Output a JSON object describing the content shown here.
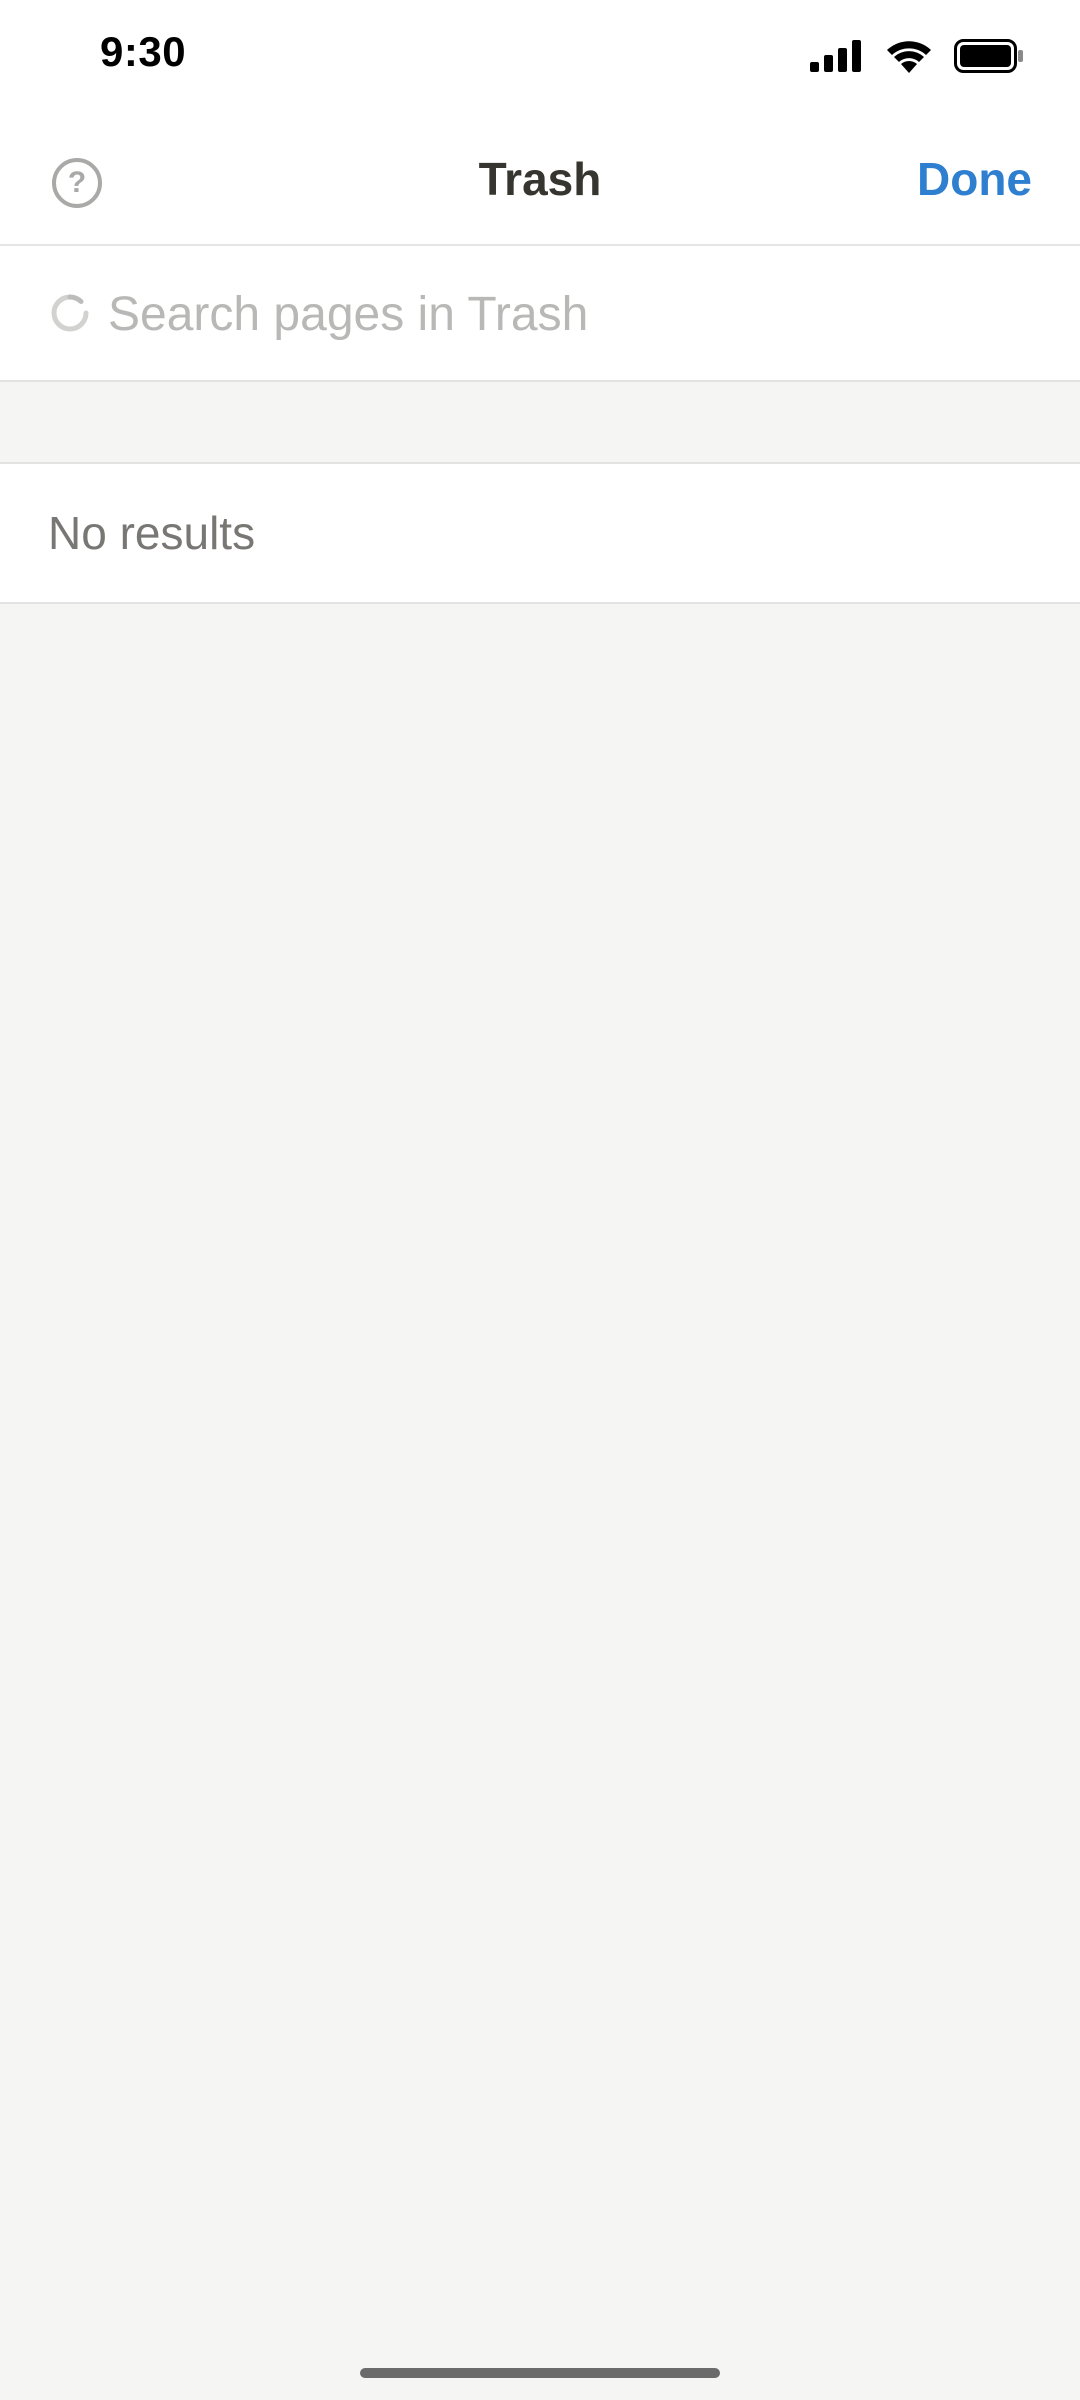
{
  "status_bar": {
    "time": "9:30",
    "icons": [
      "cellular-signal-icon",
      "wifi-icon",
      "battery-icon"
    ]
  },
  "nav": {
    "title": "Trash",
    "help_icon": "question-circle-icon",
    "help_glyph": "?",
    "done_label": "Done"
  },
  "search": {
    "placeholder": "Search pages in Trash",
    "value": "",
    "icon": "loading-spinner-icon"
  },
  "results": {
    "empty_text": "No results"
  },
  "colors": {
    "accent": "#2e7fd0",
    "title": "#37352f",
    "muted_text": "#787774",
    "placeholder": "#b8b8b6",
    "background": "#f5f5f4"
  }
}
